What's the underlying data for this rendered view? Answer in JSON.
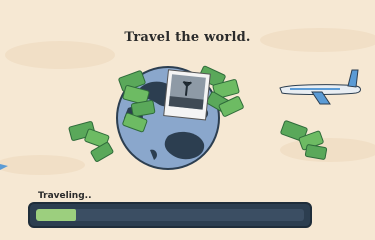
{
  "header": {
    "title": "Travel the world."
  },
  "loading": {
    "label": "Traveling..",
    "progress": 0.15
  },
  "colors": {
    "background": "#f6e8d3",
    "globe_ocean": "#8aa7cc",
    "globe_land": "#2c3e50",
    "money": "#5aa85a",
    "progress_track": "#2c3e50",
    "progress_fill": "#9ccf7e"
  },
  "icons": [
    "globe-icon",
    "polaroid-photo-icon",
    "money-stack-icon",
    "airplane-icon"
  ]
}
